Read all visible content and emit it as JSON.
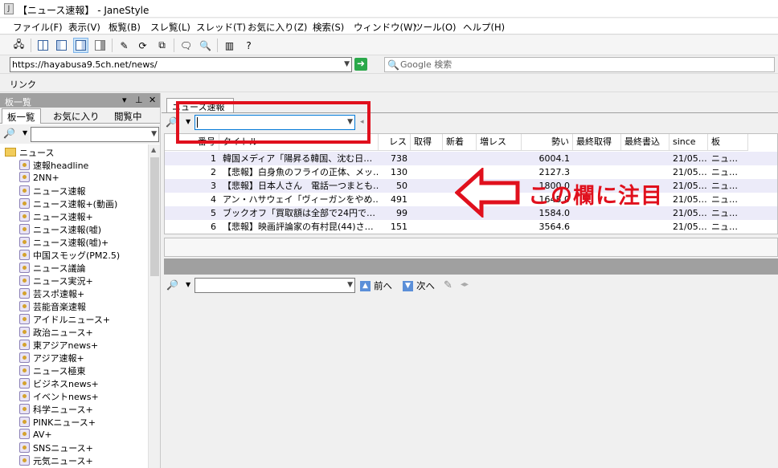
{
  "window": {
    "title": "【ニュース速報】 - JaneStyle"
  },
  "menu": [
    "ファイル(F)",
    "表示(V)",
    "板覧(B)",
    "スレ覧(L)",
    "スレッド(T)",
    "お気に入り(Z)",
    "検索(S)",
    "ウィンドウ(W)",
    "ツール(O)",
    "ヘルプ(H)"
  ],
  "address": {
    "url": "https://hayabusa9.5ch.net/news/"
  },
  "search": {
    "placeholder": "Google 検索"
  },
  "linkbar": {
    "label": "リンク"
  },
  "board_pane": {
    "title": "板一覧",
    "tabs": [
      "板一覧",
      "お気に入り",
      "閲覧中"
    ],
    "folder": "ニュース",
    "boards": [
      "速報headline",
      "2NN+",
      "ニュース速報",
      "ニュース速報+(動画)",
      "ニュース速報+",
      "ニュース速報(嘘)",
      "ニュース速報(嘘)+",
      "中国スモッグ(PM2.5)",
      "ニュース議論",
      "ニュース実況+",
      "芸スポ速報+",
      "芸能音楽速報",
      "アイドルニュース+",
      "政治ニュース+",
      "東アジアnews+",
      "アジア速報+",
      "ニュース極東",
      "ビジネスnews+",
      "イベントnews+",
      "科学ニュース+",
      "PINKニュース+",
      "AV+",
      "SNSニュース+",
      "元気ニュース+"
    ]
  },
  "thread_list": {
    "tab": "ニュース速報",
    "columns": [
      "番号",
      "タイトル",
      "レス",
      "取得",
      "新着",
      "増レス",
      "勢い",
      "最終取得",
      "最終書込",
      "since",
      "板"
    ],
    "rows": [
      {
        "no": "1",
        "title": "韓国メディア「陽昇る韓国、沈む日…",
        "res": "738",
        "ikioi": "6004.1",
        "since": "21/05…",
        "ita": "ニュ…"
      },
      {
        "no": "2",
        "title": "【悲報】白身魚のフライの正体、メッ…",
        "res": "130",
        "ikioi": "2127.3",
        "since": "21/05…",
        "ita": "ニュ…"
      },
      {
        "no": "3",
        "title": "【悲報】日本人さん　電話一つまとも…",
        "res": "50",
        "ikioi": "1800.0",
        "since": "21/05…",
        "ita": "ニュ…"
      },
      {
        "no": "4",
        "title": "アン・ハサウェイ「ヴィーガンをやめ…",
        "res": "491",
        "ikioi": "1645.0",
        "since": "21/05…",
        "ita": "ニュ…"
      },
      {
        "no": "5",
        "title": "ブックオフ「買取額は全部で24円で…",
        "res": "99",
        "ikioi": "1584.0",
        "since": "21/05…",
        "ita": "ニュ…"
      },
      {
        "no": "6",
        "title": "【悲報】映画評論家の有村昆(44)さ…",
        "res": "151",
        "ikioi": "3564.6",
        "since": "21/05…",
        "ita": "ニュ…"
      }
    ]
  },
  "viewer": {
    "prev_label": "前へ",
    "next_label": "次へ"
  },
  "annotation": {
    "text": "この欄に注目",
    "color": "#e0101d"
  }
}
